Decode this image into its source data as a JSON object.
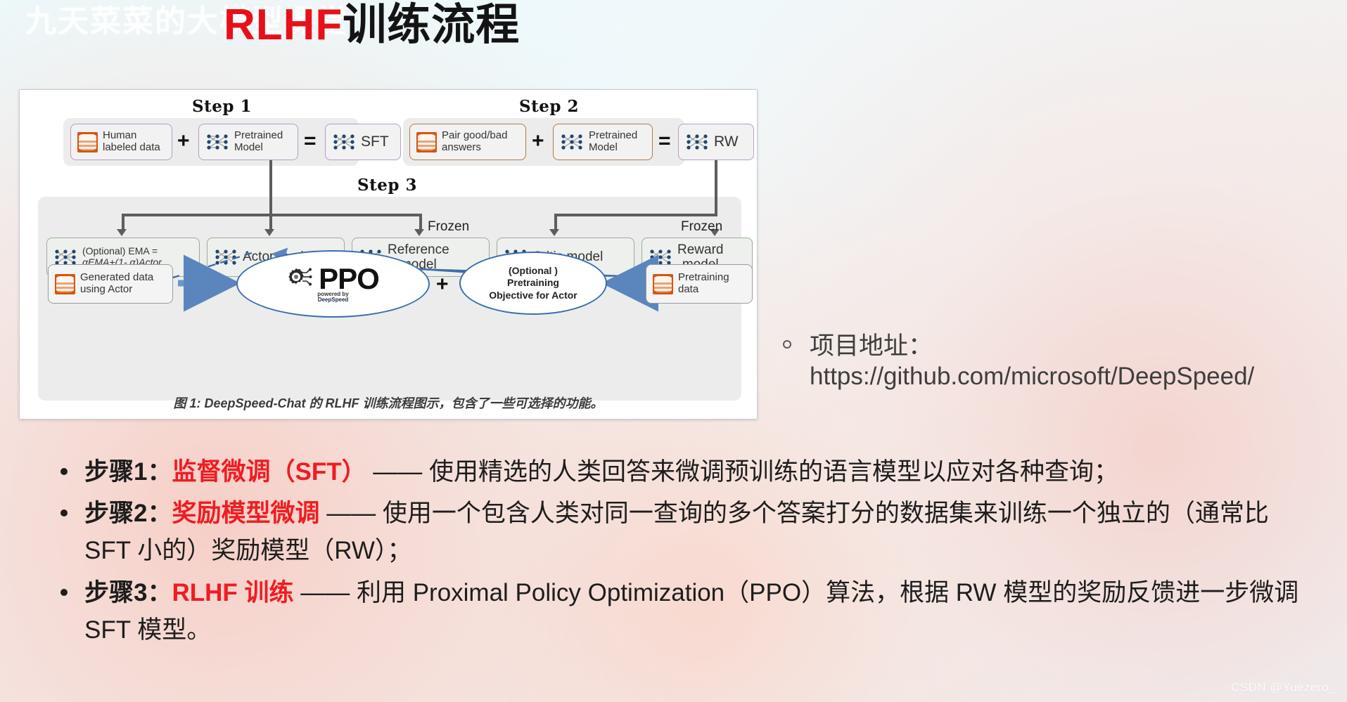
{
  "watermark": {
    "text": "九天菜菜的大模型课堂",
    "csdn": "CSDN @Yuezero_"
  },
  "title": {
    "red": "RLHF",
    "black": "训练流程"
  },
  "figure": {
    "caption": "图 1: DeepSpeed-Chat 的 RLHF 训练流程图示，包含了一些可选择的功能。",
    "step1_label": "Step 1",
    "step2_label": "Step 2",
    "step3_label": "Step 3",
    "frozen_left": "Frozen",
    "frozen_right": "Frozen",
    "plus1": "+",
    "equals1": "=",
    "plus2": "+",
    "equals2": "=",
    "plus3": "+",
    "step1": {
      "data_box_line1": "Human",
      "data_box_line2": "labeled data",
      "model_box_line1": "Pretrained",
      "model_box_line2": "Model",
      "result_box": "SFT"
    },
    "step2": {
      "data_box_line1": "Pair good/bad",
      "data_box_line2": "answers",
      "model_box_line1": "Pretrained",
      "model_box_line2": "Model",
      "result_box": "RW"
    },
    "step3": {
      "ema_line1": "(Optional) EMA =",
      "ema_line2": "αEMA+(1- α)Actor",
      "actor": "Actor model",
      "reference_line1": "Reference",
      "reference_line2": "model",
      "critic": "Critic model",
      "reward_line1": "Reward",
      "reward_line2": "model",
      "generated_line1": "Generated data",
      "generated_line2": "using Actor",
      "ppo_text": "PPO",
      "ppo_powered": "powered by",
      "ppo_brand": "DeepSpeed",
      "optional_line1": "(Optional )",
      "optional_line2": "Pretraining",
      "optional_line3": "Objective for Actor",
      "pretrain_line1": "Pretraining",
      "pretrain_line2": "data"
    }
  },
  "right_note": {
    "label": "项目地址：",
    "url": "https://github.com/microsoft/DeepSpeed/"
  },
  "steps_list": [
    {
      "prefix": "步骤1：",
      "highlight": "监督微调（SFT）",
      "body": " —— 使用精选的人类回答来微调预训练的语言模型以应对各种查询；"
    },
    {
      "prefix": "步骤2：",
      "highlight": "奖励模型微调",
      "body": " —— 使用一个包含人类对同一查询的多个答案打分的数据集来训练一个独立的（通常比 SFT 小的）奖励模型（RW）；"
    },
    {
      "prefix": "步骤3：",
      "highlight": "RLHF 训练",
      "body": " —— 利用 Proximal Policy Optimization（PPO）算法，根据 RW 模型的奖励反馈进一步微调 SFT 模型。"
    }
  ],
  "colors": {
    "title_red": "#e8101a",
    "highlight_red": "#ef1c22",
    "connector_grey": "#5d5d5d",
    "blue": "#3a6fb0",
    "panel_grey": "#ececec"
  }
}
